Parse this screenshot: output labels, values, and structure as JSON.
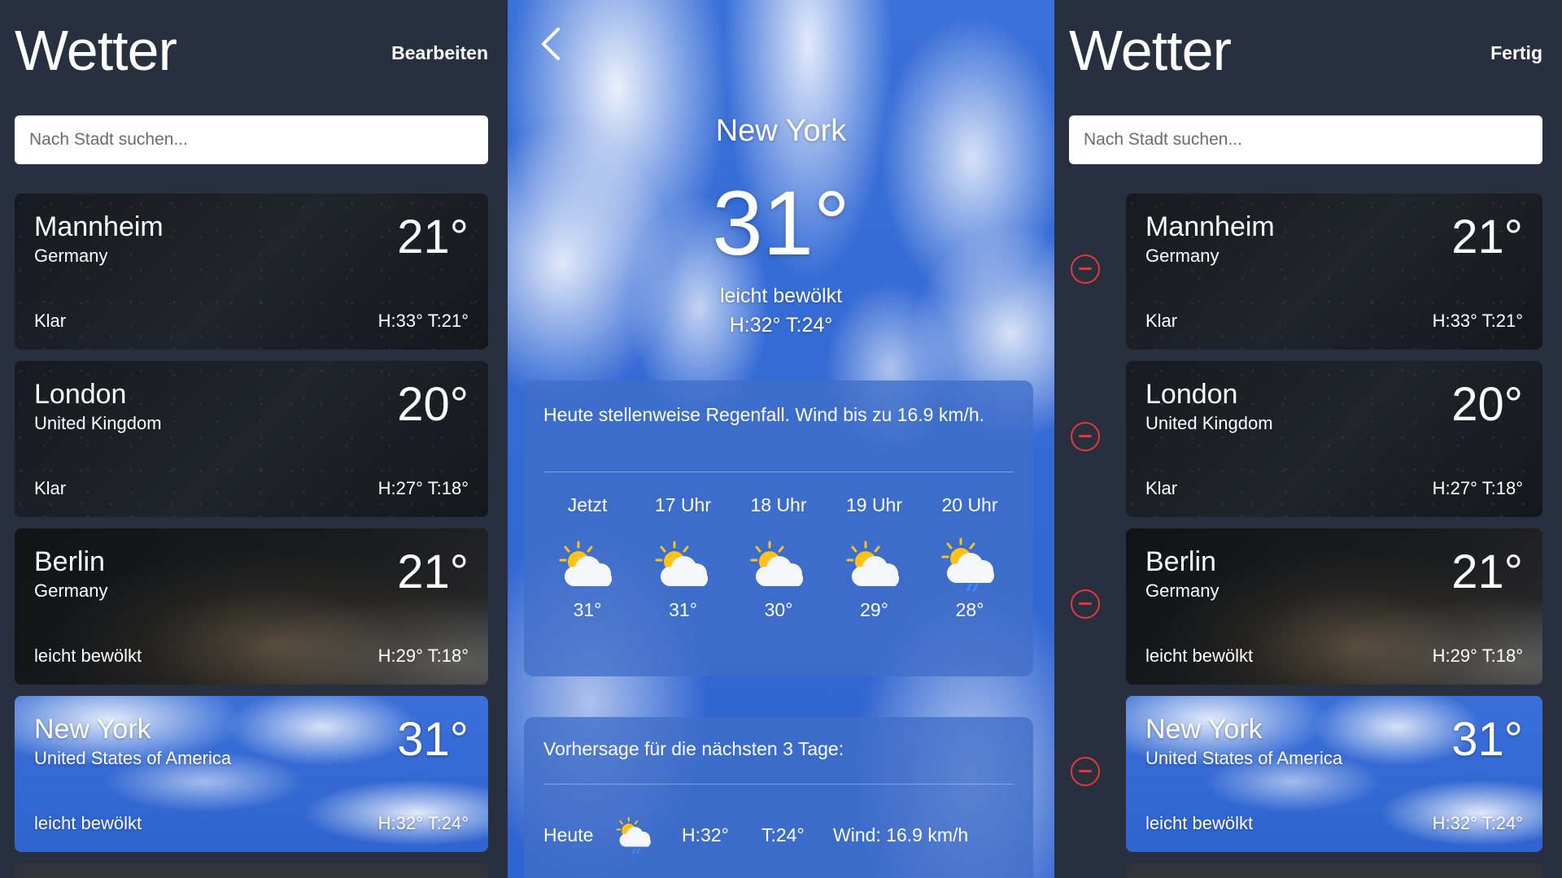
{
  "left": {
    "title": "Wetter",
    "action": "Bearbeiten",
    "search_placeholder": "Nach Stadt suchen...",
    "cities": [
      {
        "city": "Mannheim",
        "country": "Germany",
        "temp": "21°",
        "condition": "Klar",
        "hl": "H:33° T:21°",
        "theme": "night"
      },
      {
        "city": "London",
        "country": "United Kingdom",
        "temp": "20°",
        "condition": "Klar",
        "hl": "H:27° T:18°",
        "theme": "night"
      },
      {
        "city": "Berlin",
        "country": "Germany",
        "temp": "21°",
        "condition": "leicht bewölkt",
        "hl": "H:29° T:18°",
        "theme": "cloudynight"
      },
      {
        "city": "New York",
        "country": "United States of America",
        "temp": "31°",
        "condition": "leicht bewölkt",
        "hl": "H:32° T:24°",
        "theme": "sky"
      }
    ]
  },
  "detail": {
    "city": "New York",
    "temp": "31°",
    "condition": "leicht bewölkt",
    "hl": "H:32° T:24°",
    "summary": "Heute stellenweise Regenfall. Wind bis zu 16.9 km/h.",
    "hours": [
      {
        "label": "Jetzt",
        "temp": "31°",
        "icon": "partly-cloudy-icon"
      },
      {
        "label": "17 Uhr",
        "temp": "31°",
        "icon": "partly-cloudy-icon"
      },
      {
        "label": "18 Uhr",
        "temp": "30°",
        "icon": "partly-cloudy-icon"
      },
      {
        "label": "19 Uhr",
        "temp": "29°",
        "icon": "partly-cloudy-icon"
      },
      {
        "label": "20 Uhr",
        "temp": "28°",
        "icon": "partly-cloudy-rain-icon"
      }
    ],
    "forecast_title": "Vorhersage für die nächsten 3 Tage:",
    "forecast": [
      {
        "day": "Heute",
        "hi": "H:32°",
        "lo": "T:24°",
        "wind": "Wind: 16.9 km/h",
        "icon": "partly-cloudy-rain-icon"
      }
    ]
  },
  "right": {
    "title": "Wetter",
    "action": "Fertig",
    "search_placeholder": "Nach Stadt suchen..."
  },
  "colors": {
    "accent_red": "#e53935",
    "panel_bg": "#283040",
    "sky_blue": "#3a70d9"
  }
}
